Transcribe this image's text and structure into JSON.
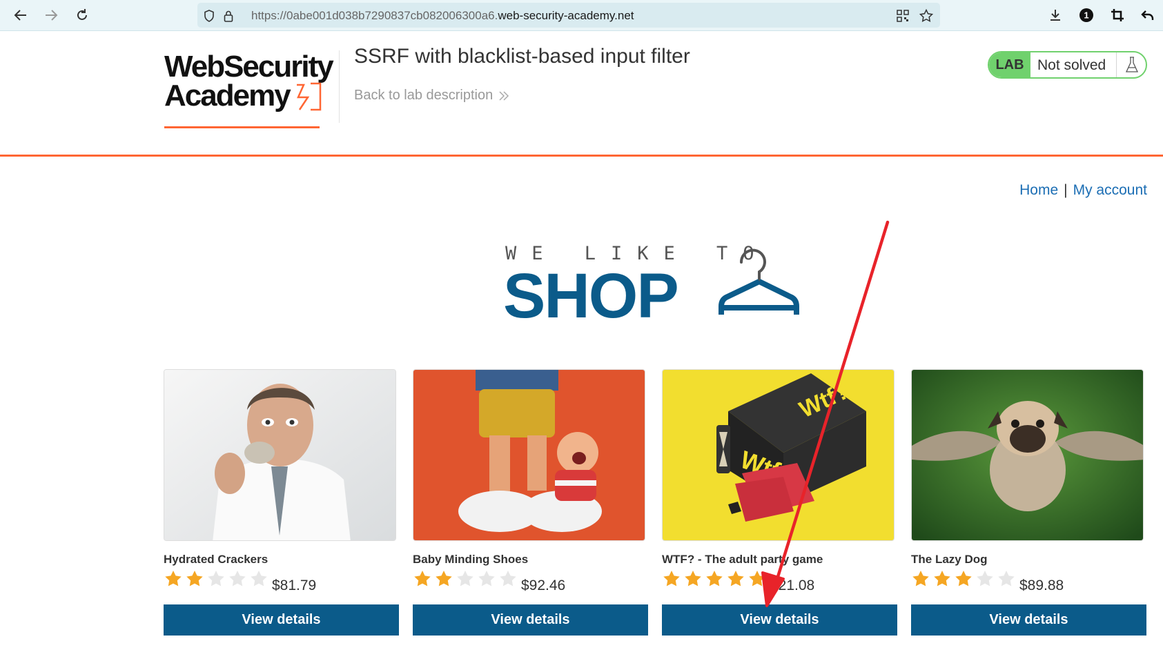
{
  "browser": {
    "url_prefix": "https://0abe001d038b7290837cb082006300a6.",
    "url_host": "web-security-academy.net",
    "icons": [
      "back-icon",
      "forward-icon",
      "reload-icon",
      "shield-icon",
      "lock-icon",
      "qr-code-icon",
      "star-icon",
      "download-icon",
      "extension-icon",
      "crop-icon",
      "undo-icon"
    ],
    "extension_badge": "1"
  },
  "header": {
    "logo_line1": "WebSecurity",
    "logo_line2": "Academy",
    "title": "SSRF with blacklist-based input filter",
    "back_link": "Back to lab description",
    "status_label": "LAB",
    "status_text": "Not solved",
    "accent_color": "#ff6633",
    "status_color": "#70d16d"
  },
  "nav": {
    "home": "Home",
    "separator": "|",
    "account": "My account"
  },
  "banner": {
    "small": "WE LIKE TO",
    "big": "SHOP",
    "color": "#0b5b8a"
  },
  "products": [
    {
      "name": "Hydrated Crackers",
      "price": "$81.79",
      "rating": 2,
      "button": "View details"
    },
    {
      "name": "Baby Minding Shoes",
      "price": "$92.46",
      "rating": 2,
      "button": "View details"
    },
    {
      "name": "WTF? - The adult party game",
      "price": "$21.08",
      "rating": 5,
      "button": "View details"
    },
    {
      "name": "The Lazy Dog",
      "price": "$89.88",
      "rating": 3,
      "button": "View details"
    }
  ],
  "annotation": {
    "type": "arrow",
    "color": "#e8232a"
  }
}
